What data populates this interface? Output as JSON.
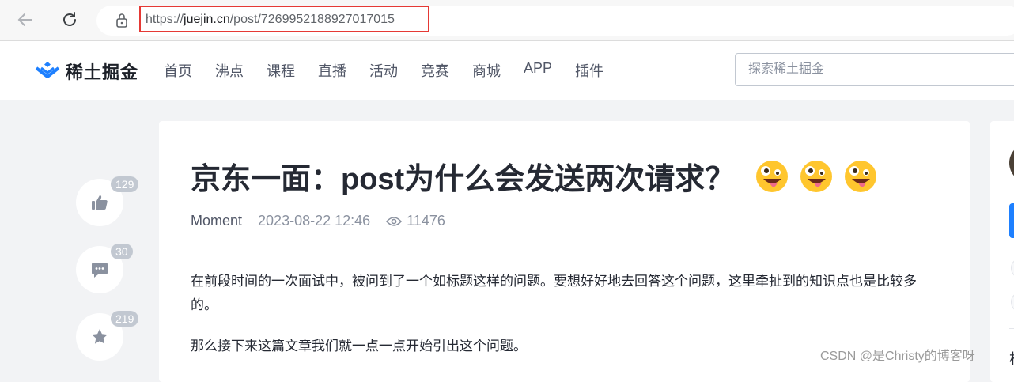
{
  "browser": {
    "url_prefix": "https://",
    "url_domain": "juejin.cn",
    "url_path": "/post/7269952188927017015"
  },
  "header": {
    "logo_text": "稀土掘金",
    "nav": [
      "首页",
      "沸点",
      "课程",
      "直播",
      "活动",
      "竞赛",
      "商城",
      "APP",
      "插件"
    ],
    "search_placeholder": "探索稀土掘金"
  },
  "actions": {
    "like_count": "129",
    "comment_count": "30",
    "collect_count": "219"
  },
  "article": {
    "title": "京东一面：post为什么会发送两次请求？",
    "author": "Moment",
    "date": "2023-08-22 12:46",
    "views": "11476",
    "paragraphs": [
      "在前段时间的一次面试中，被问到了一个如标题这样的问题。要想好好地去回答这个问题，这里牵扯到的知识点也是比较多的。",
      "那么接下来这篇文章我们就一点一点开始引出这个问题。"
    ]
  },
  "sidebar": {
    "partial_char": "相"
  },
  "watermark": "CSDN @是Christy的博客呀",
  "colors": {
    "brand_blue": "#1e80ff",
    "highlight_red": "#e53935",
    "page_bg": "#f2f3f5"
  }
}
